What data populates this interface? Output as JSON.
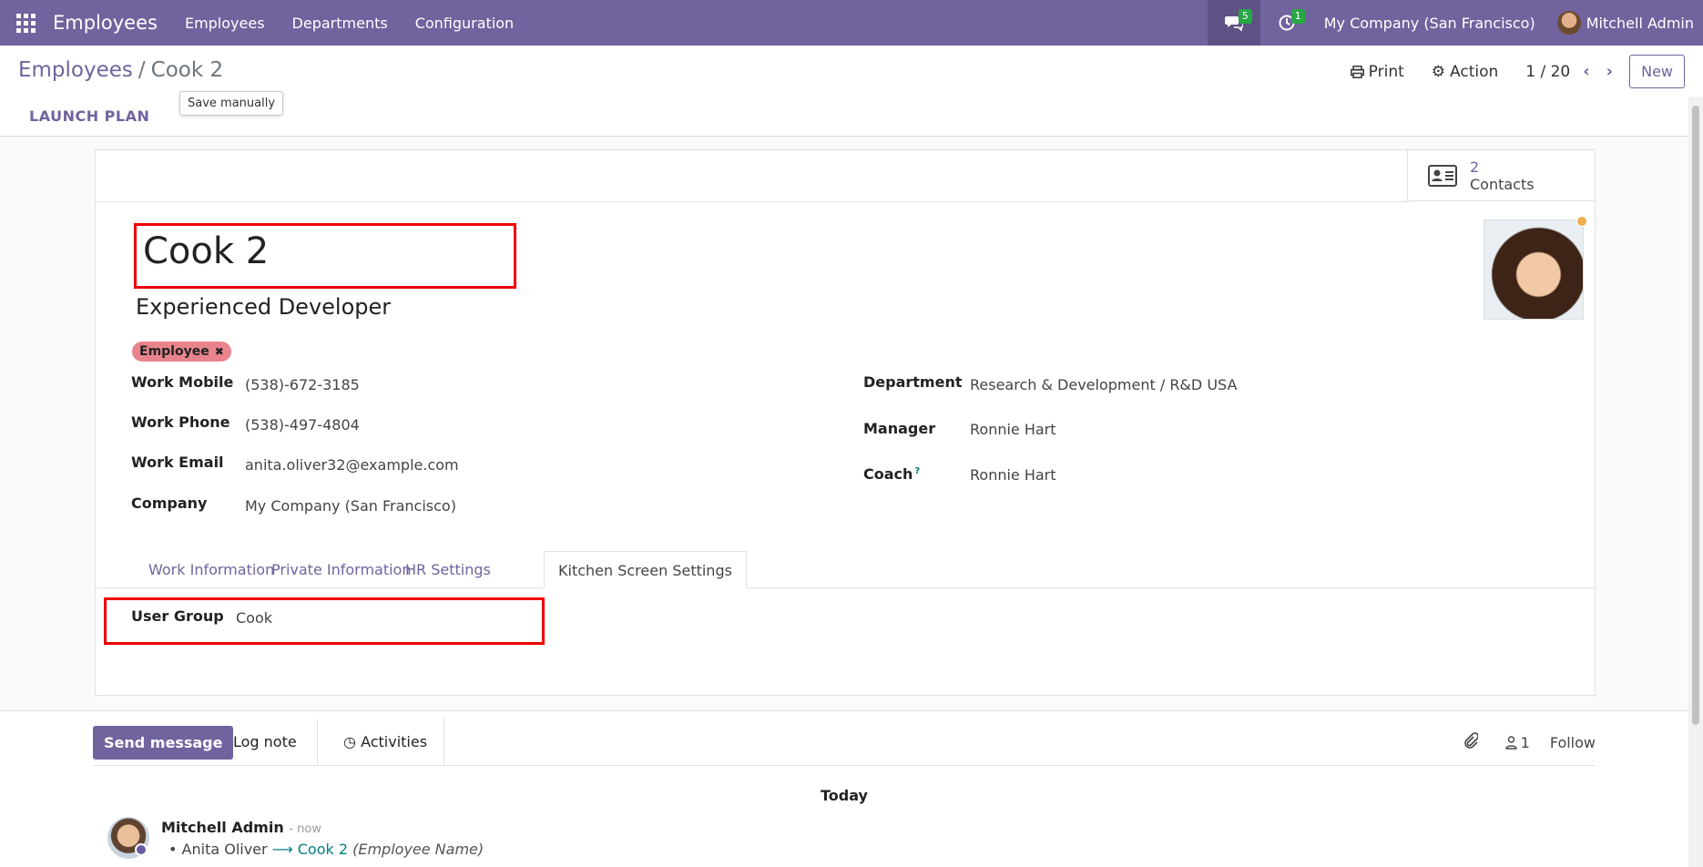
{
  "topnav": {
    "brand": "Employees",
    "menu": [
      "Employees",
      "Departments",
      "Configuration"
    ],
    "messages_count": "5",
    "activities_count": "1",
    "company": "My Company (San Francisco)",
    "user": "Mitchell Admin"
  },
  "control": {
    "breadcrumb_root": "Employees",
    "breadcrumb_sep": "/",
    "breadcrumb_current": "Cook 2",
    "tooltip": "Save manually",
    "launch_plan": "LAUNCH PLAN",
    "print": "Print",
    "action": "Action",
    "pager": "1 / 20",
    "new": "New"
  },
  "form": {
    "contacts_count": "2",
    "contacts_label": "Contacts",
    "name": "Cook 2",
    "job_title": "Experienced Developer",
    "tag": "Employee",
    "left_fields": [
      {
        "label": "Work Mobile",
        "value": "(538)-672-3185"
      },
      {
        "label": "Work Phone",
        "value": "(538)-497-4804"
      },
      {
        "label": "Work Email",
        "value": "anita.oliver32@example.com"
      },
      {
        "label": "Company",
        "value": "My Company (San Francisco)"
      }
    ],
    "right_fields": [
      {
        "label": "Department",
        "value": "Research & Development / R&D USA"
      },
      {
        "label": "Manager",
        "value": "Ronnie Hart"
      },
      {
        "label": "Coach",
        "value": "Ronnie Hart",
        "help": "?"
      }
    ],
    "tabs": [
      "Work Information",
      "Private Information",
      "HR Settings",
      "Kitchen Screen Settings"
    ],
    "user_group_label": "User Group",
    "user_group_value": "Cook"
  },
  "chatter": {
    "send_message": "Send message",
    "log_note": "Log note",
    "activities": "Activities",
    "followers_count": "1",
    "follow": "Follow",
    "today": "Today",
    "author": "Mitchell Admin",
    "time": "- now",
    "old_value": "Anita Oliver",
    "new_value": "Cook 2",
    "field_name": "(Employee Name)"
  },
  "colors": {
    "brand": "#71639e",
    "highlight_border": "#e00000",
    "tag": "#e9848d"
  }
}
